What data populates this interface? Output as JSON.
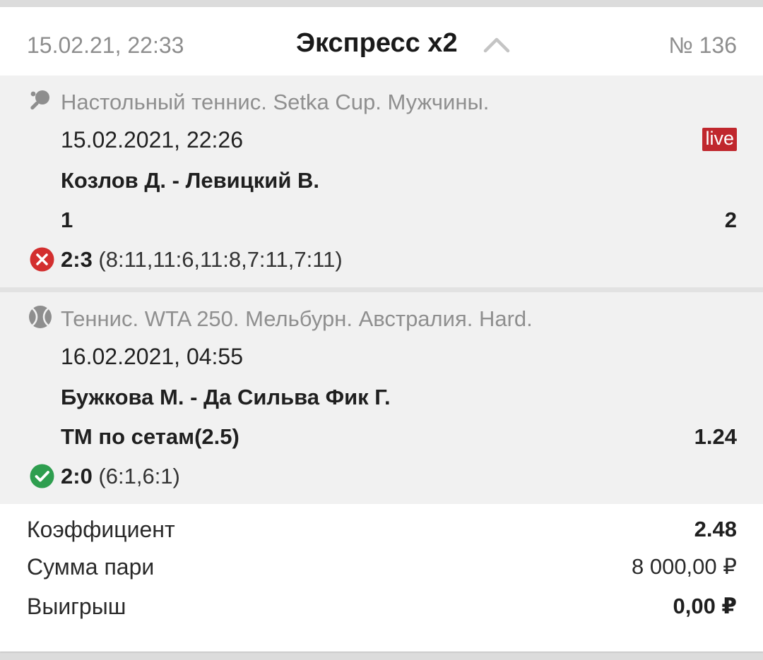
{
  "header": {
    "date": "15.02.21, 22:33",
    "title": "Экспресс x2",
    "number": "№ 136"
  },
  "events": [
    {
      "sport_icon": "table-tennis-icon",
      "league": "Настольный теннис. Setka Cup. Мужчины.",
      "date": "15.02.2021, 22:26",
      "badge": "live",
      "teams": "Козлов Д. - Левицкий В.",
      "bet": "1",
      "odds": "2",
      "result_status": "lost",
      "result_icon": "lost-x-icon",
      "score": "2:3",
      "sets": " (8:11,11:6,11:8,7:11,7:11)"
    },
    {
      "sport_icon": "tennis-ball-icon",
      "league": "Теннис. WTA 250. Мельбурн. Австралия. Hard.",
      "date": "16.02.2021, 04:55",
      "teams": "Бужкова М. - Да Сильва Фик Г.",
      "bet": "ТМ по сетам(2.5)",
      "odds": "1.24",
      "result_status": "won",
      "result_icon": "won-check-icon",
      "score": "2:0",
      "sets": " (6:1,6:1)"
    }
  ],
  "summary": {
    "coef_label": "Коэффициент",
    "coef_value": "2.48",
    "stake_label": "Сумма пари",
    "stake_value": "8 000,00 ₽",
    "win_label": "Выигрыш",
    "win_value": "0,00 ₽"
  },
  "colors": {
    "live": "#c0272d",
    "lost": "#d32f2f",
    "won": "#2e9e4f",
    "muted": "#8e8e8e",
    "event_bg": "#f1f1f1"
  }
}
